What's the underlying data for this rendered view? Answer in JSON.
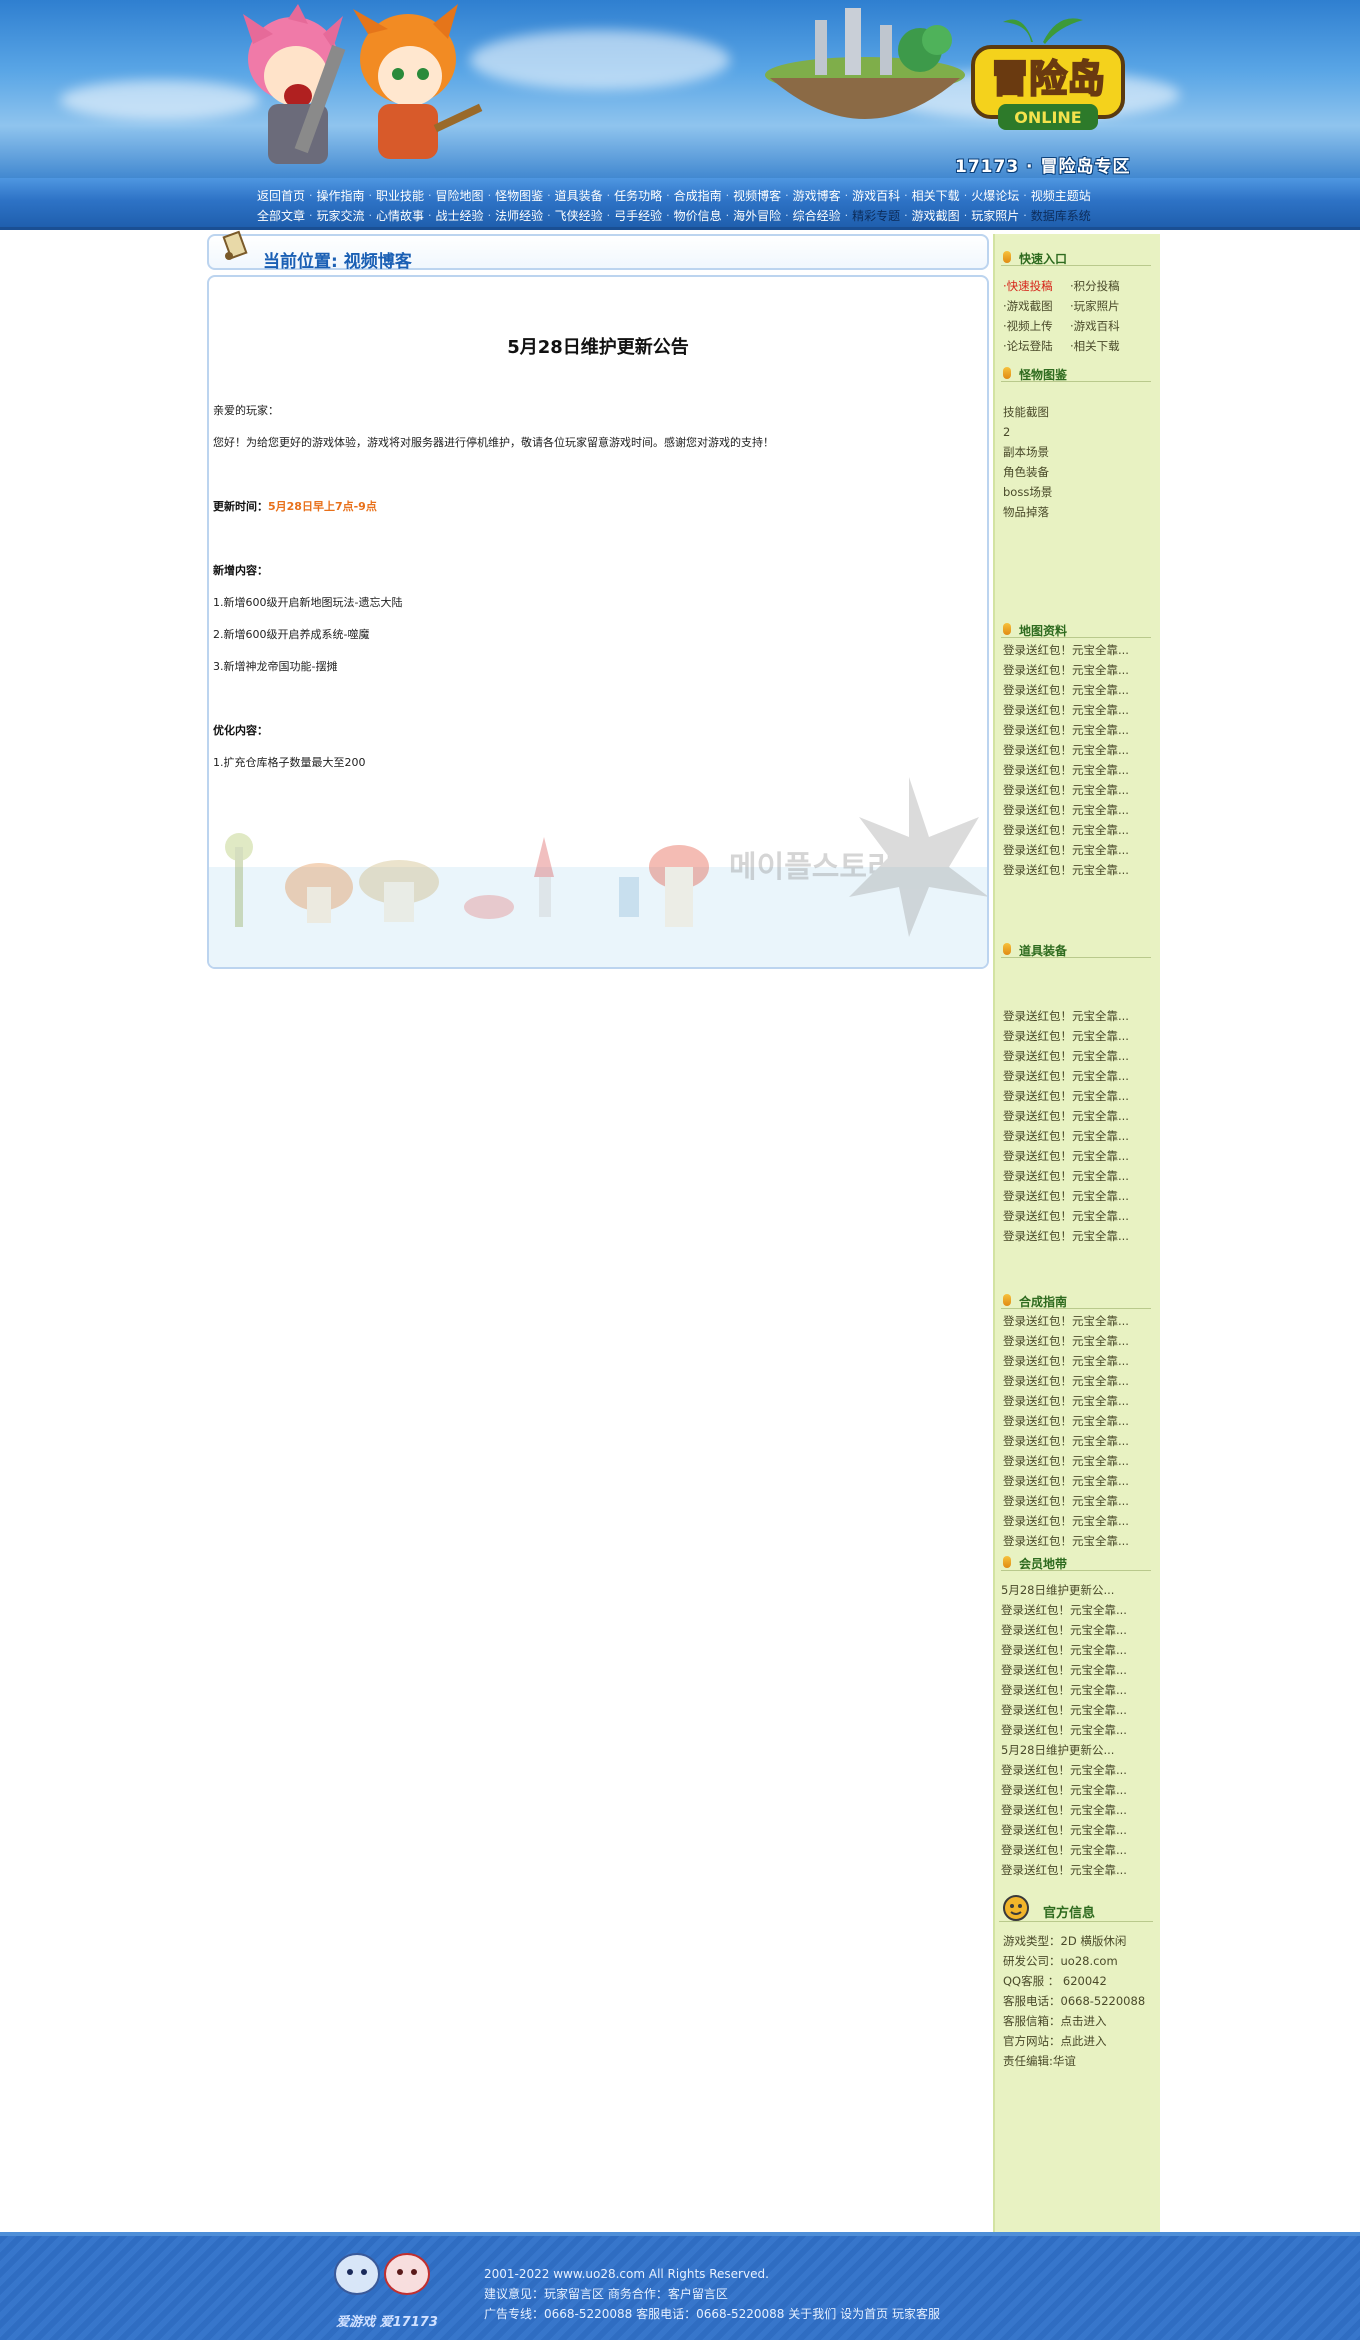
{
  "header": {
    "site_tag": "17173 · 冒险岛专区",
    "logo_text": "冒险岛",
    "logo_sub": "ONLINE"
  },
  "nav": {
    "row1": [
      "返回首页",
      "操作指南",
      "职业技能",
      "冒险地图",
      "怪物图鉴",
      "道具装备",
      "任务功略",
      "合成指南",
      "视频博客",
      "游戏博客",
      "游戏百科",
      "相关下载",
      "火爆论坛",
      "视频主题站"
    ],
    "row2": [
      "全部文章",
      "玩家交流",
      "心情故事",
      "战士经验",
      "法师经验",
      "飞侠经验",
      "弓手经验",
      "物价信息",
      "海外冒险",
      "综合经验",
      "精彩专题",
      "游戏截图",
      "玩家照片",
      "数据库系统"
    ]
  },
  "breadcrumb": {
    "text": "当前位置: 视频博客"
  },
  "article": {
    "title": "5月28日维护更新公告",
    "greeting": "亲爱的玩家：",
    "intro": "您好！为给您更好的游戏体验，游戏将对服务器进行停机维护，敬请各位玩家留意游戏时间。感谢您对游戏的支持！",
    "time_label": "更新时间：",
    "time_value": "5月28日早上7点-9点",
    "new_label": "新增内容：",
    "new_items": [
      "1.新增600级开启新地图玩法-遗忘大陆",
      "2.新增600级开启养成系统-噬魔",
      "3.新增神龙帝国功能-摆摊"
    ],
    "opt_label": "优化内容：",
    "opt_items": [
      "1.扩充仓库格子数量最大至200"
    ]
  },
  "sidebar": {
    "quick": {
      "title": "快速入口",
      "items": [
        "·快速投稿",
        "·积分投稿",
        "·游戏截图",
        "·玩家照片",
        "·视频上传",
        "·游戏百科",
        "·论坛登陆",
        "·相关下载"
      ]
    },
    "monster": {
      "title": "怪物图鉴",
      "items": [
        "技能截图",
        "2",
        "副本场景",
        "角色装备",
        "boss场景",
        "物品掉落"
      ]
    },
    "map": {
      "title": "地图资料",
      "items": [
        "登录送红包！元宝全靠...",
        "登录送红包！元宝全靠...",
        "登录送红包！元宝全靠...",
        "登录送红包！元宝全靠...",
        "登录送红包！元宝全靠...",
        "登录送红包！元宝全靠...",
        "登录送红包！元宝全靠...",
        "登录送红包！元宝全靠...",
        "登录送红包！元宝全靠...",
        "登录送红包！元宝全靠...",
        "登录送红包！元宝全靠...",
        "登录送红包！元宝全靠..."
      ]
    },
    "equip": {
      "title": "道具装备",
      "items": [
        "登录送红包！元宝全靠...",
        "登录送红包！元宝全靠...",
        "登录送红包！元宝全靠...",
        "登录送红包！元宝全靠...",
        "登录送红包！元宝全靠...",
        "登录送红包！元宝全靠...",
        "登录送红包！元宝全靠...",
        "登录送红包！元宝全靠...",
        "登录送红包！元宝全靠...",
        "登录送红包！元宝全靠...",
        "登录送红包！元宝全靠...",
        "登录送红包！元宝全靠..."
      ]
    },
    "craft": {
      "title": "合成指南",
      "items": [
        "登录送红包！元宝全靠...",
        "登录送红包！元宝全靠...",
        "登录送红包！元宝全靠...",
        "登录送红包！元宝全靠...",
        "登录送红包！元宝全靠...",
        "登录送红包！元宝全靠...",
        "登录送红包！元宝全靠...",
        "登录送红包！元宝全靠...",
        "登录送红包！元宝全靠...",
        "登录送红包！元宝全靠...",
        "登录送红包！元宝全靠...",
        "登录送红包！元宝全靠..."
      ]
    },
    "member": {
      "title": "会员地带",
      "items": [
        "5月28日维护更新公...",
        "登录送红包！元宝全靠...",
        "登录送红包！元宝全靠...",
        "登录送红包！元宝全靠...",
        "登录送红包！元宝全靠...",
        "登录送红包！元宝全靠...",
        "登录送红包！元宝全靠...",
        "登录送红包！元宝全靠...",
        "5月28日维护更新公...",
        "登录送红包！元宝全靠...",
        "登录送红包！元宝全靠...",
        "登录送红包！元宝全靠...",
        "登录送红包！元宝全靠...",
        "登录送红包！元宝全靠...",
        "登录送红包！元宝全靠..."
      ]
    },
    "official": {
      "title": "官方信息",
      "items": [
        "游戏类型：2D 横版休闲",
        "研发公司：uo28.com",
        "QQ客服 ：  620042",
        "客服电话：0668-5220088",
        "客服信箱：点击进入",
        "官方网站：点此进入",
        "责任编辑:华谊"
      ]
    }
  },
  "footer": {
    "mascot_text": "爱游戏  爱17173",
    "line1": "2001-2022 www.uo28.com All Rights Reserved.",
    "line2": "建议意见：玩家留言区    商务合作：客户留言区",
    "line3_a": "广告专线：0668-5220088    客服电话：0668-5220088",
    "link_about": "关于我们",
    "link_home": "设为首页",
    "link_support": "玩家客服"
  }
}
